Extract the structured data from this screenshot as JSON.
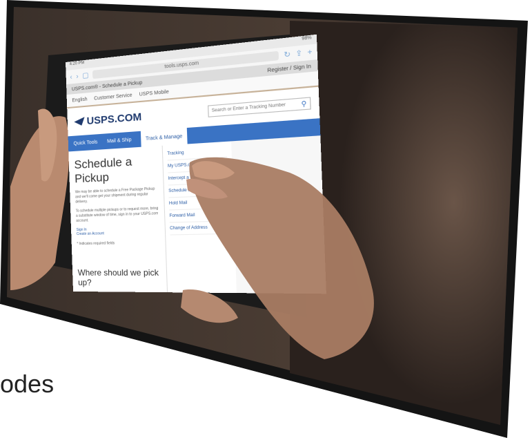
{
  "tablet": {
    "status_time": "4:20 PM",
    "status_battery": "98%",
    "url": "tools.usps.com",
    "tab_title": "USPS.com® - Schedule a Pickup",
    "tab_right": "Register / Sign In",
    "util_links": [
      "English",
      "Customer Service",
      "USPS Mobile"
    ],
    "logo_text": "USPS.COM",
    "search_placeholder": "Search or Enter a Tracking Number",
    "nav": {
      "quick_tools": "Quick Tools",
      "mail_ship": "Mail & Ship",
      "track_manage": "Track & Manage"
    },
    "page_title": "Schedule a Pickup",
    "intro": "We may be able to schedule a Free Package Pickup and we'll come get your shipment during regular delivery.",
    "intro2": "To schedule multiple pickups or to request more, bring a substitute window of time, sign in to your USPS.com account.",
    "sign_in": "Sign In",
    "create_account": "Create an Account",
    "required_note": "* Indicates required fields",
    "sub_heading": "Where should we pick up?",
    "menu_items": [
      "Tracking",
      "My USPS.com",
      "Intercept a Package",
      "Schedule a Redelivery",
      "Hold Mail",
      "Forward Mail",
      "Change of Address"
    ]
  },
  "caption": "odes",
  "colors": {
    "usps_blue": "#3a73c4",
    "usps_navy": "#1f3a6e",
    "frame_black": "#141414"
  }
}
